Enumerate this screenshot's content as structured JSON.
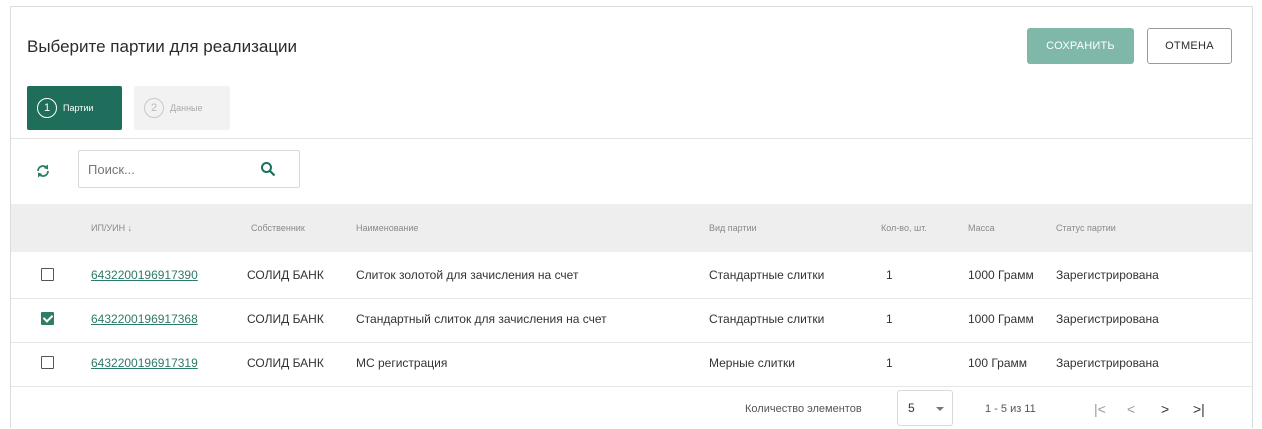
{
  "header": {
    "title": "Выберите партии для реализации",
    "save_label": "СОХРАНИТЬ",
    "cancel_label": "ОТМЕНА"
  },
  "steps": [
    {
      "num": "1",
      "label": "Партии",
      "active": true
    },
    {
      "num": "2",
      "label": "Данные",
      "active": false
    }
  ],
  "toolbar": {
    "search_placeholder": "Поиск...",
    "refresh_icon": "refresh-icon",
    "search_icon": "search-icon"
  },
  "table": {
    "columns": [
      "ИП/УИН ↓",
      "Собственник",
      "Наименование",
      "Вид партии",
      "Кол-во, шт.",
      "Масса",
      "Статус партии"
    ],
    "rows": [
      {
        "checked": false,
        "id": "6432200196917390",
        "owner": "СОЛИД БАНК",
        "name": "Слиток золотой для зачисления на счет",
        "type": "Стандартные слитки",
        "qty": "1",
        "mass": "1000 Грамм",
        "status": "Зарегистрирована"
      },
      {
        "checked": true,
        "id": "6432200196917368",
        "owner": "СОЛИД БАНК",
        "name": "Стандартный слиток для зачисления на счет",
        "type": "Стандартные слитки",
        "qty": "1",
        "mass": "1000 Грамм",
        "status": "Зарегистрирована"
      },
      {
        "checked": false,
        "id": "6432200196917319",
        "owner": "СОЛИД БАНК",
        "name": "МС регистрация",
        "type": "Мерные слитки",
        "qty": "1",
        "mass": "100 Грамм",
        "status": "Зарегистрирована"
      }
    ]
  },
  "pagination": {
    "page_size_label": "Количество элементов",
    "page_size": "5",
    "range": "1 - 5 из 11",
    "first": "|<",
    "prev": "<",
    "next": ">",
    "last": ">|"
  },
  "colors": {
    "accent": "#1f6e5b",
    "save_button": "#7fb8a9",
    "link": "#2d7a68"
  }
}
